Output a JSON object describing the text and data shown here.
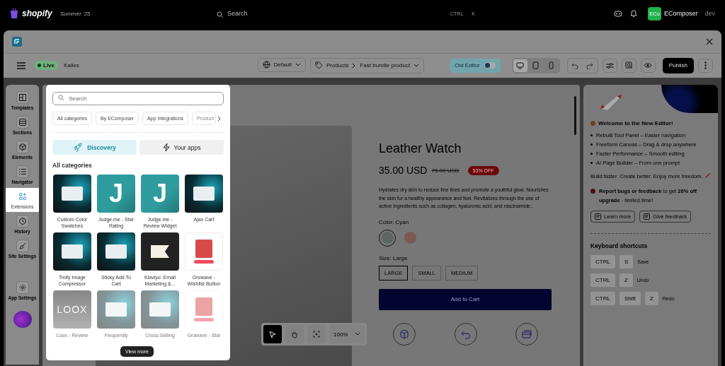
{
  "topbar": {
    "brand": "shopify",
    "edition": "Summer '25",
    "search_placeholder": "Search",
    "shortcut": [
      "CTRL",
      "K"
    ],
    "avatar": "ECo",
    "store": "EComposer",
    "role": "dev"
  },
  "toolbar": {
    "status": "Live",
    "store": "Kalles",
    "theme": "Default",
    "breadcrumb": [
      "Products",
      "Fast bundle product"
    ],
    "old_editor": {
      "label": "Old Editor",
      "on": false
    },
    "devices": [
      {
        "kind": "desktop",
        "selected": true
      },
      {
        "kind": "tablet",
        "selected": false
      },
      {
        "kind": "mobile",
        "selected": false
      }
    ],
    "publish": "Publish"
  },
  "sidebar": {
    "items": [
      {
        "label": "Templates",
        "selected": false
      },
      {
        "label": "Sections",
        "selected": false
      },
      {
        "label": "Elements",
        "selected": false
      },
      {
        "label": "Navigator",
        "selected": false
      },
      {
        "label": "Extensions",
        "selected": true
      },
      {
        "label": "History",
        "selected": false
      },
      {
        "label": "Site Settings",
        "selected": false
      }
    ],
    "bottom_item": {
      "label": "App Settings"
    }
  },
  "extensions": {
    "search_placeholder": "Search",
    "categories": [
      "All categories",
      "By EComposer",
      "App Integrations",
      "Product"
    ],
    "tabs": [
      {
        "label": "Discovery",
        "selected": true
      },
      {
        "label": "Your apps",
        "selected": false
      }
    ],
    "section_title": "All categories",
    "apps": [
      {
        "name": "Custom Color Swatches",
        "kind": "screen"
      },
      {
        "name": "Judge.me - Star Rating",
        "kind": "letter",
        "logo": "J"
      },
      {
        "name": "Judge.me - Review Widget",
        "kind": "letter",
        "logo": "J"
      },
      {
        "name": "Ajax Cart",
        "kind": "screen"
      },
      {
        "name": "Tinify Image Compressor",
        "kind": "screen"
      },
      {
        "name": "Sticky Add To Cart",
        "kind": "screen"
      },
      {
        "name": "Klaviyo: Email Marketing &...",
        "kind": "flag"
      },
      {
        "name": "Growave - Wishlist Button",
        "kind": "card"
      },
      {
        "name": "Loox - Review",
        "kind": "wordmark",
        "logo": "LOOX"
      },
      {
        "name": "Frequently",
        "kind": "screen"
      },
      {
        "name": "Cross-Selling",
        "kind": "screen"
      },
      {
        "name": "Growave - Star",
        "kind": "card"
      }
    ],
    "view_more": "View more"
  },
  "product": {
    "title": "Leather Watch",
    "price": "35.00 USD",
    "compare_price": "75.00 USD",
    "discount": "53% OFF",
    "description": "Hydrates dry skin to reduce fine lines and promote a youthful glow. Nourishes the skin for a healthy appearance and feel. Revitalizes through the use of active ingredients such as collagen, hyaluronic acid, and niacinamide..",
    "color_label": "Color: Cyan",
    "swatches": [
      {
        "selected": true
      },
      {
        "selected": false
      }
    ],
    "size_label": "Size: Large",
    "sizes": [
      {
        "label": "LARGE",
        "selected": true
      },
      {
        "label": "SMALL",
        "selected": false
      },
      {
        "label": "MEDIUM",
        "selected": false
      }
    ],
    "add_to_cart": "Add to Cart"
  },
  "canvas_tools": {
    "tools": [
      {
        "kind": "pointer",
        "selected": true
      },
      {
        "kind": "hand",
        "selected": false
      },
      {
        "kind": "focus",
        "selected": false
      }
    ],
    "zoom": "100%"
  },
  "welcome": {
    "title": "Welcome to the New Editor!",
    "bullets": [
      "Rebuilt Tool Panel – Easier navigation",
      "Freeform Canvas – Drag & drop anywhere",
      "Faster Performance – Smooth editing",
      "AI Page Builder – From one prompt"
    ],
    "tagline": "Build faster. Create better. Enjoy more freedom.",
    "report": "**Report bugs or feedback** to get **20% off upgrade** - limited time!",
    "buttons": [
      "Learn more",
      "Give feedback"
    ]
  },
  "shortcuts": {
    "title": "Keyboard shortcuts",
    "items": [
      {
        "keys": [
          "CTRL",
          "S"
        ],
        "action": "Save"
      },
      {
        "keys": [
          "CTRL",
          "Z"
        ],
        "action": "Undo"
      },
      {
        "keys": [
          "CTRL",
          "Shift",
          "Z"
        ],
        "action": "Redo"
      }
    ]
  }
}
